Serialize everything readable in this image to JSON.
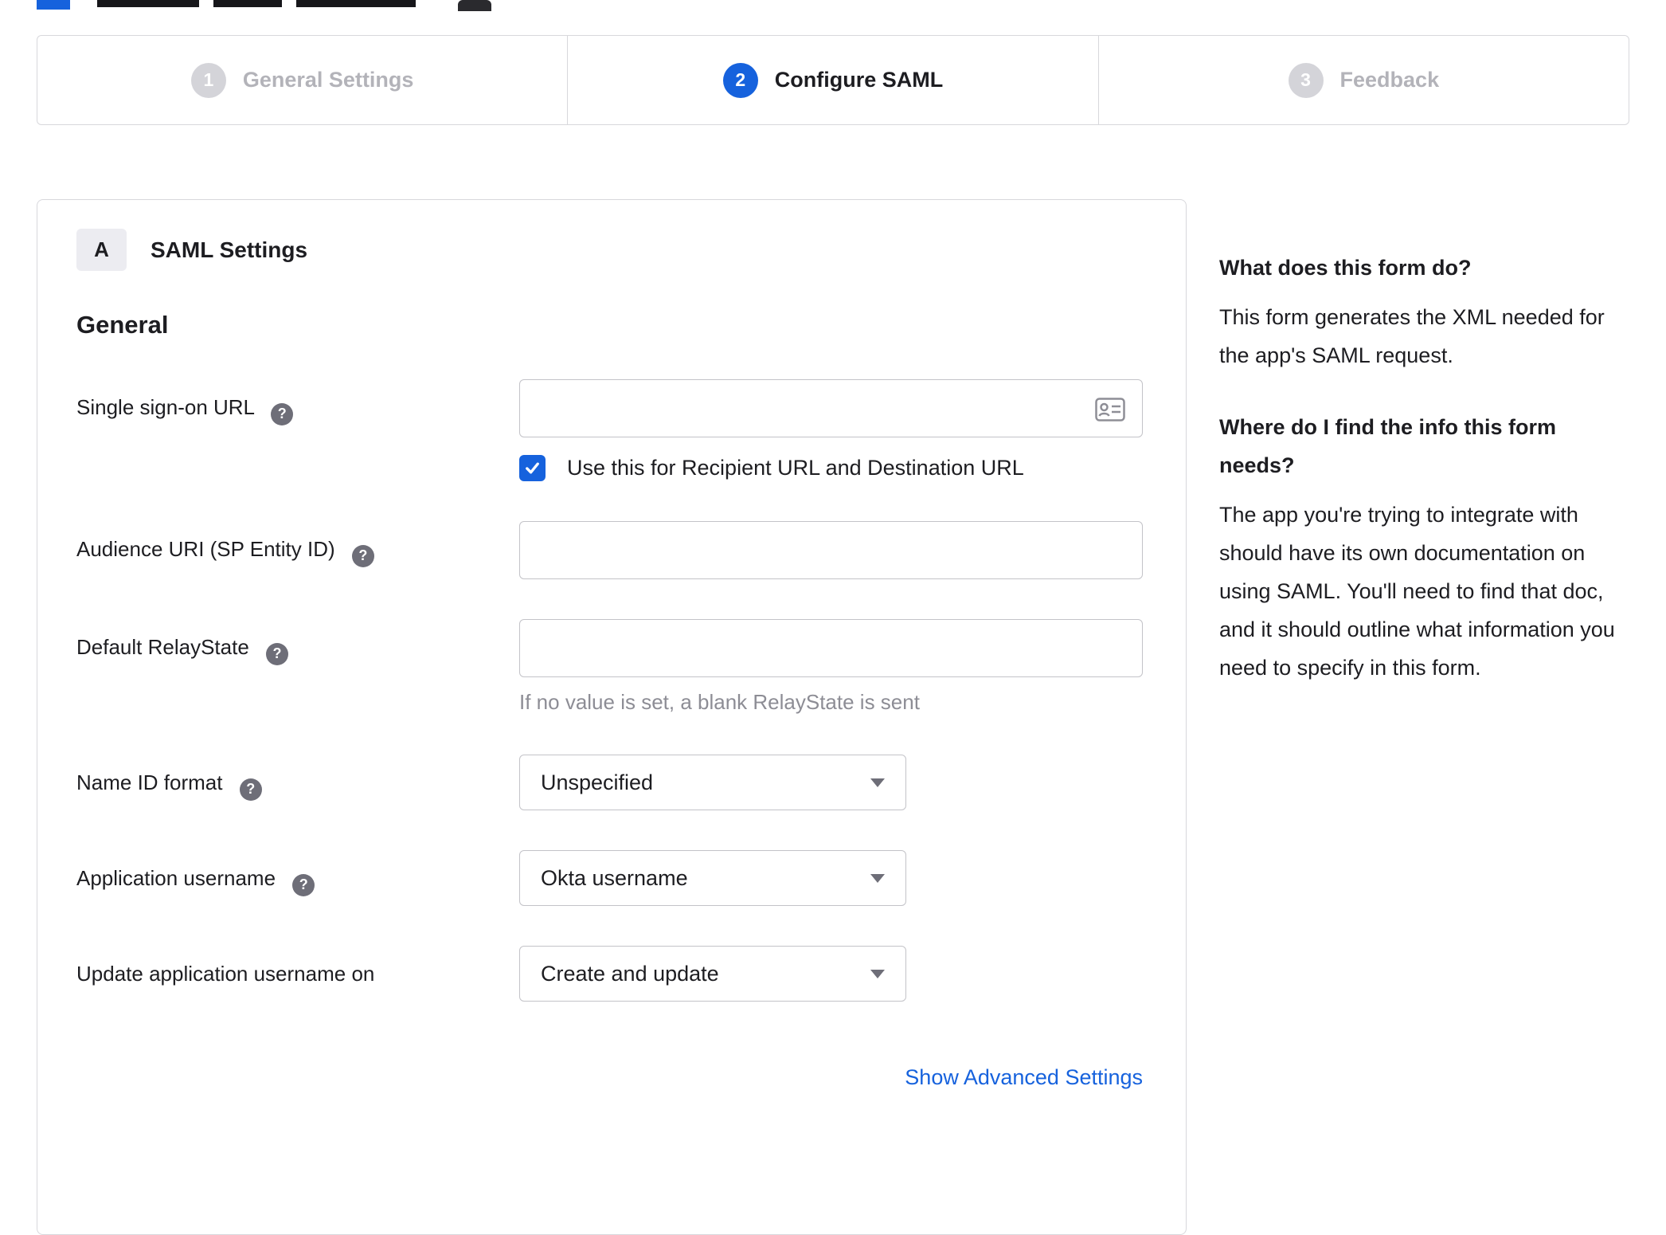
{
  "stepper": {
    "steps": [
      {
        "number": "1",
        "label": "General Settings",
        "state": "complete"
      },
      {
        "number": "2",
        "label": "Configure SAML",
        "state": "active"
      },
      {
        "number": "3",
        "label": "Feedback",
        "state": "upcoming"
      }
    ]
  },
  "form": {
    "badge": "A",
    "section_title": "SAML Settings",
    "group_title": "General",
    "sso": {
      "label": "Single sign-on URL",
      "value": "",
      "checkbox_label": "Use this for Recipient URL and Destination URL",
      "checked": true
    },
    "audience": {
      "label": "Audience URI (SP Entity ID)",
      "value": ""
    },
    "relay": {
      "label": "Default RelayState",
      "value": "",
      "hint": "If no value is set, a blank RelayState is sent"
    },
    "name_id": {
      "label": "Name ID format",
      "value": "Unspecified"
    },
    "app_username": {
      "label": "Application username",
      "value": "Okta username"
    },
    "update_username": {
      "label": "Update application username on",
      "value": "Create and update"
    },
    "advanced_link": "Show Advanced Settings"
  },
  "help": {
    "q1": "What does this form do?",
    "a1": "This form generates the XML needed for the app's SAML request.",
    "q2": "Where do I find the info this form needs?",
    "a2": "The app you're trying to integrate with should have its own documentation on using SAML. You'll need to find that doc, and it should outline what information you need to specify in this form."
  },
  "icons": {
    "help_glyph": "?"
  },
  "colors": {
    "accent": "#1662dd",
    "link": "#1662dd",
    "inactive": "#b3b3b9"
  }
}
